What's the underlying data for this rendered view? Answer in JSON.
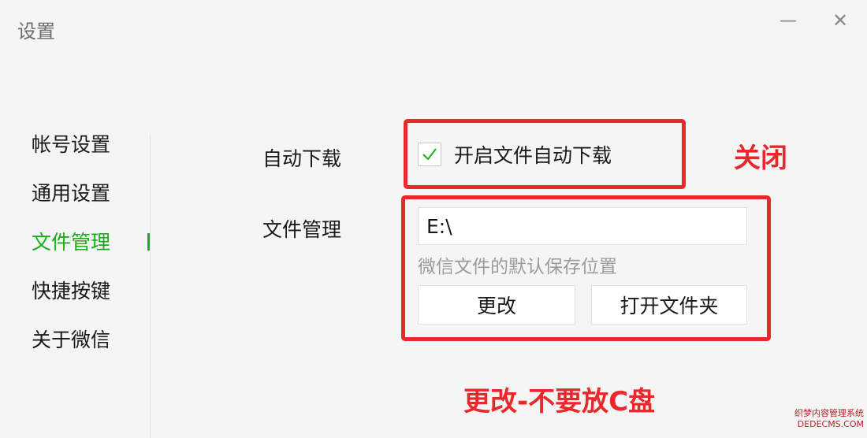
{
  "window": {
    "title": "设置",
    "minimize_symbol": "—",
    "close_symbol": "✕"
  },
  "sidebar": {
    "items": [
      {
        "label": "帐号设置",
        "active": false
      },
      {
        "label": "通用设置",
        "active": false
      },
      {
        "label": "文件管理",
        "active": true
      },
      {
        "label": "快捷按键",
        "active": false
      },
      {
        "label": "关于微信",
        "active": false
      }
    ]
  },
  "settings": {
    "auto_download": {
      "label": "自动下载",
      "checkbox_label": "开启文件自动下载",
      "checked": true
    },
    "file_management": {
      "label": "文件管理",
      "path_value": "E:\\",
      "hint": "微信文件的默认保存位置",
      "change_button": "更改",
      "open_folder_button": "打开文件夹"
    }
  },
  "annotations": {
    "close_note": "关闭",
    "change_note": "更改-不要放C盘"
  },
  "watermark": {
    "line1": "织梦内容管理系统",
    "line2": "DEDECMS.COM"
  },
  "colors": {
    "accent_green": "#1aad19",
    "annotation_red": "#e8282a"
  }
}
